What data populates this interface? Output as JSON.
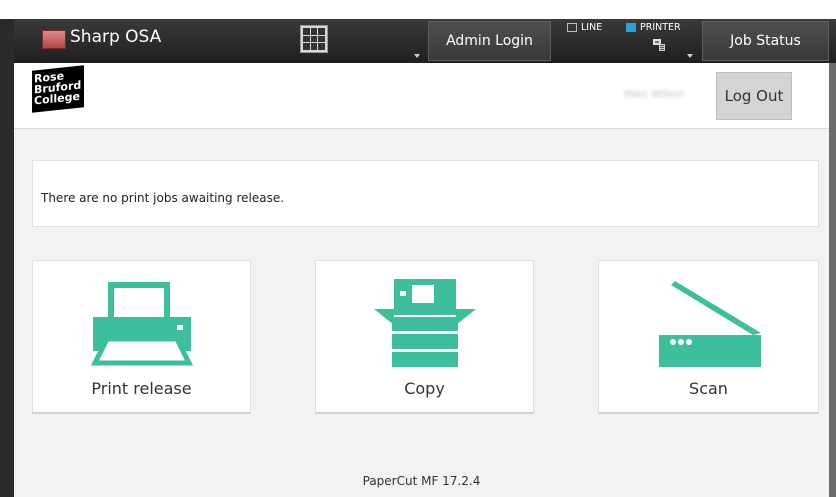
{
  "header": {
    "app_title": "Sharp OSA",
    "admin_login_label": "Admin Login",
    "line_label": "LINE",
    "printer_label": "PRINTER",
    "job_status_label": "Job Status"
  },
  "subheader": {
    "logo_lines": [
      "Rose",
      "Bruford",
      "College"
    ],
    "user_name": "Marc Wilson",
    "logout_label": "Log Out"
  },
  "notice": {
    "message": "There are no print jobs awaiting release."
  },
  "tiles": [
    {
      "label": "Print release",
      "icon": "printer-icon"
    },
    {
      "label": "Copy",
      "icon": "copier-icon"
    },
    {
      "label": "Scan",
      "icon": "scanner-icon"
    }
  ],
  "footer": {
    "version": "PaperCut MF 17.2.4"
  },
  "colors": {
    "accent": "#3dbf9b",
    "printer_mode": "#29a3e0",
    "header_bg": "#2a2a2a"
  }
}
